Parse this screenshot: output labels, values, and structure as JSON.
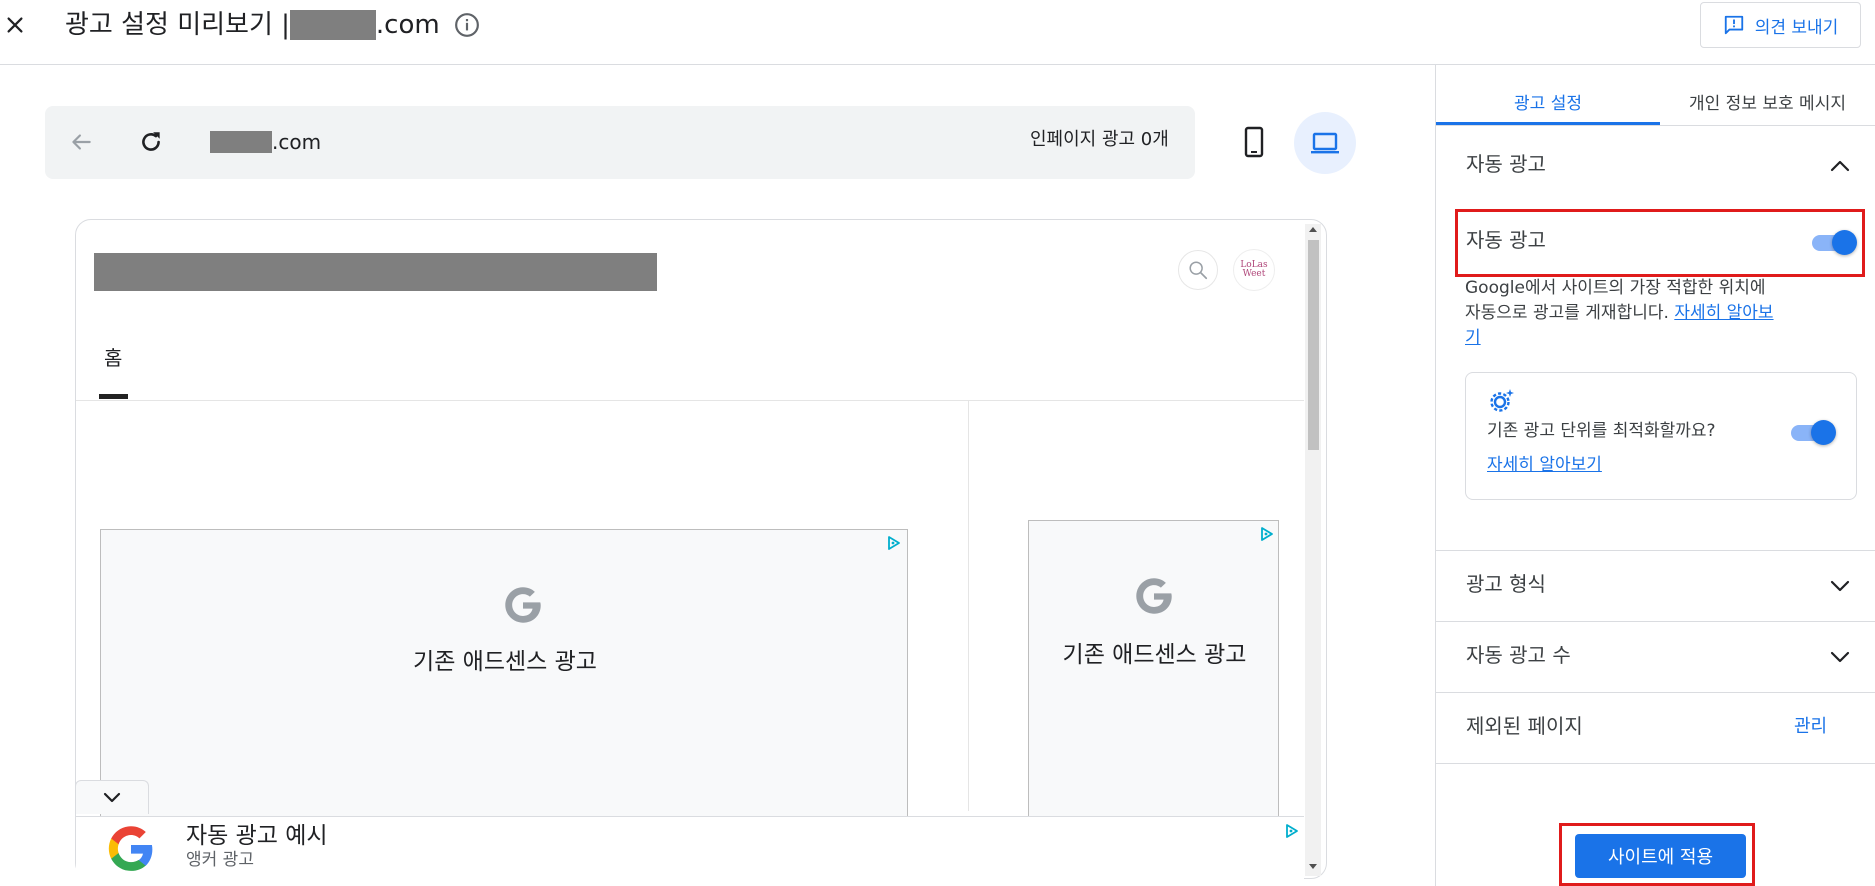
{
  "header": {
    "title_prefix": "광고 설정 미리보기 |",
    "title_suffix": ".com",
    "feedback_label": "의견 보내기"
  },
  "preview": {
    "url_suffix": ".com",
    "inpage_ads_count": "인페이지 광고 0개",
    "home_tab_label": "홈",
    "logo_text_line1": "LoLas",
    "logo_text_line2": "Weet",
    "ad_main_label": "기존 애드센스 광고",
    "ad_side_label": "기존 애드센스 광고",
    "anchor_title": "자동 광고 예시",
    "anchor_subtitle": "앵커 광고"
  },
  "panel": {
    "tabs": [
      {
        "label": "광고 설정",
        "active": true
      },
      {
        "label": "개인 정보 보호 메시지",
        "active": false
      }
    ],
    "auto_ads_section_title": "자동 광고",
    "auto_ads_toggle_label": "자동 광고",
    "auto_ads_enabled": true,
    "description": "Google에서 사이트의 가장 적합한 위치에 자동으로 광고를 게재합니다.",
    "learn_more_link": "자세히 알아보기",
    "optimize_question": "기존 광고 단위를 최적화할까요?",
    "optimize_enabled": true,
    "optimize_learn_more": "자세히 알아보기",
    "ad_formats_title": "광고 형식",
    "ad_load_title": "자동 광고 수",
    "excluded_pages_title": "제외된 페이지",
    "manage_link": "관리",
    "apply_button": "사이트에 적용"
  },
  "colors": {
    "accent": "#1a73e8",
    "highlight": "#e01b1b",
    "redaction": "#7f7f7f"
  }
}
